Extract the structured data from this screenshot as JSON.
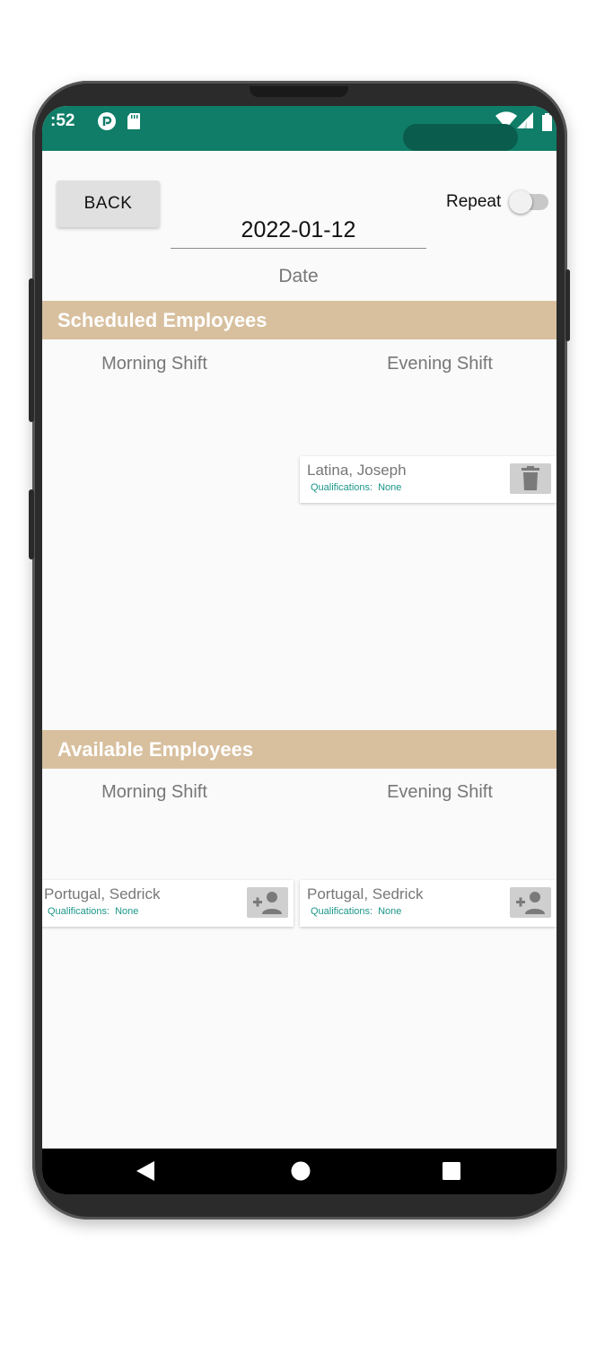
{
  "status_bar": {
    "time": ":52",
    "icons": [
      "pocket-casts-icon",
      "sd-card-icon",
      "wifi-icon",
      "cell-signal-icon",
      "battery-icon"
    ],
    "color": "#0f7d68"
  },
  "toolbar": {
    "back_label": "BACK",
    "repeat_label": "Repeat",
    "repeat_on": false
  },
  "date": {
    "value": "2022-01-12",
    "label": "Date"
  },
  "scheduled": {
    "title": "Scheduled Employees",
    "morning_title": "Morning Shift",
    "evening_title": "Evening Shift",
    "evening": [
      {
        "name": "Latina, Joseph",
        "qual_label": "Qualifications:",
        "qual_value": "None",
        "action_icon": "trash-icon"
      }
    ]
  },
  "available": {
    "title": "Available Employees",
    "morning_title": "Morning Shift",
    "evening_title": "Evening Shift",
    "morning": [
      {
        "name": "Portugal, Sedrick",
        "qual_label": "Qualifications:",
        "qual_value": "None",
        "action_icon": "add-person-icon"
      }
    ],
    "evening": [
      {
        "name": "Portugal, Sedrick",
        "qual_label": "Qualifications:",
        "qual_value": "None",
        "action_icon": "add-person-icon"
      }
    ]
  },
  "nav": {
    "icons": [
      "back-triangle-icon",
      "home-circle-icon",
      "recents-square-icon"
    ]
  },
  "colors": {
    "section_header": "#d8c09f",
    "qualification_text": "#1a9688",
    "screen_background": "#fafafa"
  }
}
